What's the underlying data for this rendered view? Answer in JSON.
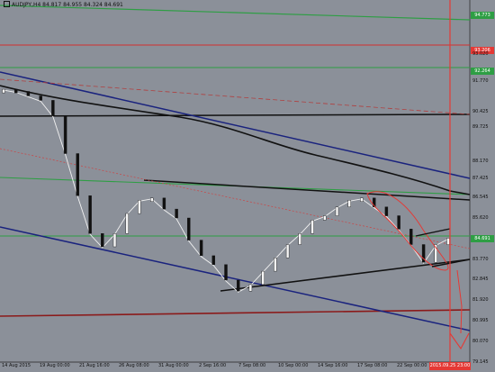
{
  "header": {
    "symbol_ohlc": "AUDJPY,H4  84.817 84.955 84.324 84.691"
  },
  "y_axis": {
    "ticks": [
      {
        "label": "94.773",
        "price": 94.773,
        "style": "tag",
        "color": "#2e9e44"
      },
      {
        "label": "93.206",
        "price": 93.206,
        "style": "tag",
        "color": "#e53935"
      },
      {
        "label": "93.020",
        "price": 93.02,
        "style": "plain"
      },
      {
        "label": "92.264",
        "price": 92.264,
        "style": "tag",
        "color": "#2e9e44"
      },
      {
        "label": "91.770",
        "price": 91.77,
        "style": "plain"
      },
      {
        "label": "90.425",
        "price": 90.425,
        "style": "plain"
      },
      {
        "label": "89.725",
        "price": 89.725,
        "style": "plain"
      },
      {
        "label": "88.170",
        "price": 88.17,
        "style": "plain"
      },
      {
        "label": "87.425",
        "price": 87.425,
        "style": "plain"
      },
      {
        "label": "86.545",
        "price": 86.545,
        "style": "plain"
      },
      {
        "label": "85.620",
        "price": 85.62,
        "style": "plain"
      },
      {
        "label": "84.691",
        "price": 84.691,
        "style": "tag",
        "color": "#2e9e44"
      },
      {
        "label": "83.770",
        "price": 83.77,
        "style": "plain"
      },
      {
        "label": "82.845",
        "price": 82.845,
        "style": "plain"
      },
      {
        "label": "81.920",
        "price": 81.92,
        "style": "plain"
      },
      {
        "label": "80.995",
        "price": 80.995,
        "style": "plain"
      },
      {
        "label": "80.070",
        "price": 80.07,
        "style": "plain"
      },
      {
        "label": "79.145",
        "price": 79.145,
        "style": "plain"
      }
    ]
  },
  "x_axis": {
    "ticks": [
      "14 Aug 2015",
      "19 Aug 00:00",
      "21 Aug 16:00",
      "26 Aug 08:00",
      "31 Aug 00:00",
      "2 Sep 16:00",
      "7 Sep 08:00",
      "10 Sep 00:00",
      "14 Sep 16:00",
      "17 Sep 08:00",
      "22 Sep 00:00"
    ],
    "current_time_label": "2015.09.25 23:00"
  },
  "chart_data": {
    "type": "line",
    "title": "AUDJPY,H4",
    "series": [
      {
        "name": "",
        "x": [
          "14 Aug",
          "15 Aug",
          "17 Aug",
          "18 Aug",
          "19 Aug",
          "20 Aug",
          "21 Aug",
          "22 Aug",
          "24 Aug",
          "25 Aug",
          "26 Aug",
          "27 Aug",
          "28 Aug",
          "29 Aug",
          "31 Aug",
          "1 Sep",
          "2 Sep",
          "3 Sep",
          "4 Sep",
          "5 Sep",
          "7 Sep",
          "8 Sep",
          "9 Sep",
          "10 Sep",
          "11 Sep",
          "12 Sep",
          "14 Sep",
          "15 Sep",
          "16 Sep",
          "17 Sep",
          "18 Sep",
          "19 Sep",
          "21 Sep",
          "22 Sep",
          "23 Sep",
          "24 Sep",
          "25 Sep"
        ],
        "values": [
          91.4,
          91.3,
          91.1,
          90.9,
          90.2,
          88.5,
          86.6,
          84.9,
          84.3,
          84.9,
          85.8,
          86.4,
          86.5,
          86.0,
          85.6,
          84.6,
          83.9,
          83.5,
          82.8,
          82.3,
          82.6,
          83.2,
          83.8,
          84.4,
          84.9,
          85.5,
          85.7,
          86.1,
          86.4,
          86.5,
          86.1,
          85.7,
          85.1,
          84.4,
          83.6,
          84.4,
          84.691
        ]
      }
    ],
    "levels": {
      "horizontal_red": 93.206,
      "horizontal_green": [
        92.264,
        84.691
      ],
      "horizontal_black": 90.4,
      "horizontal_darkred": 81.15
    },
    "ylim": [
      79.145,
      95.3
    ],
    "grid": false,
    "xlabel": "",
    "ylabel": ""
  }
}
